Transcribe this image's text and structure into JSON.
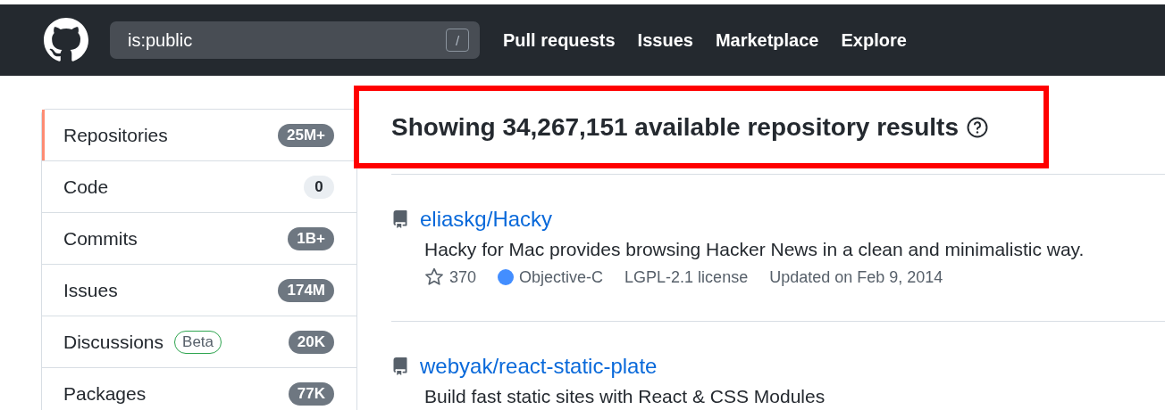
{
  "header": {
    "search": {
      "value": "is:public",
      "shortcut": "/"
    },
    "nav": [
      "Pull requests",
      "Issues",
      "Marketplace",
      "Explore"
    ]
  },
  "sidebar": {
    "items": [
      {
        "label": "Repositories",
        "count": "25M+",
        "count_emphasis": true,
        "selected": true
      },
      {
        "label": "Code",
        "count": "0",
        "count_emphasis": false,
        "selected": false
      },
      {
        "label": "Commits",
        "count": "1B+",
        "count_emphasis": true,
        "selected": false
      },
      {
        "label": "Issues",
        "count": "174M",
        "count_emphasis": true,
        "selected": false
      },
      {
        "label": "Discussions",
        "badge": "Beta",
        "count": "20K",
        "count_emphasis": true,
        "selected": false
      },
      {
        "label": "Packages",
        "count": "77K",
        "count_emphasis": true,
        "selected": false
      }
    ]
  },
  "results": {
    "heading": "Showing 34,267,151 available repository results",
    "highlighted": true,
    "repos": [
      {
        "name": "eliaskg/Hacky",
        "description": "Hacky for Mac provides browsing Hacker News in a clean and minimalistic way.",
        "stars": "370",
        "language": "Objective-C",
        "color": "#438eff",
        "license": "LGPL-2.1 license",
        "updated": "Updated on Feb 9, 2014"
      },
      {
        "name": "webyak/react-static-plate",
        "description": "Build fast static sites with React & CSS Modules"
      }
    ]
  }
}
